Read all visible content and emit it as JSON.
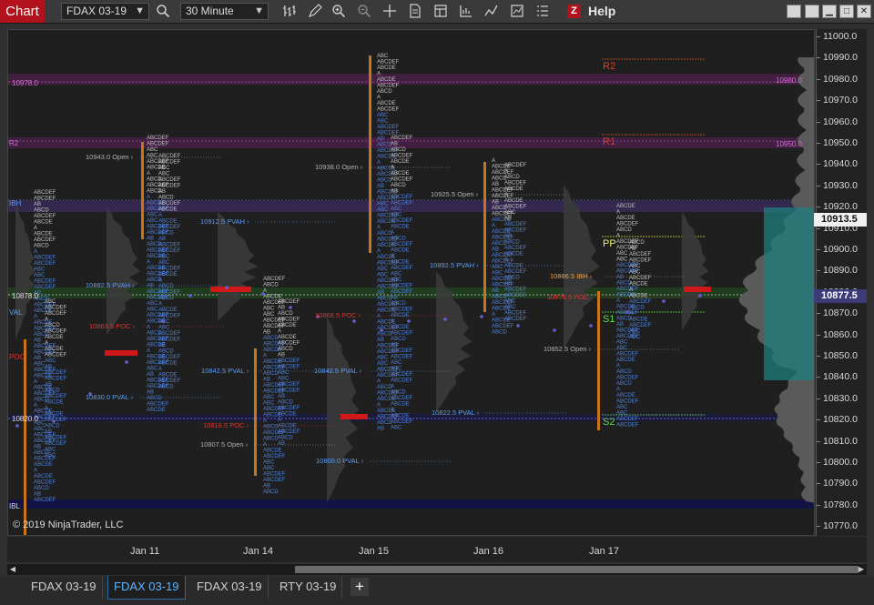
{
  "toolbar": {
    "chart_label": "Chart",
    "instrument": "FDAX 03-19",
    "interval": "30 Minute",
    "help_label": "Help",
    "z_label": "Z"
  },
  "chart": {
    "copyright": "© 2019 NinjaTrader, LLC",
    "x_labels": [
      "Jan 11",
      "Jan 14",
      "Jan 15",
      "Jan 16",
      "Jan 17"
    ],
    "y_labels": [
      "11000.0",
      "10990.0",
      "10980.0",
      "10970.0",
      "10960.0",
      "10950.0",
      "10940.0",
      "10930.0",
      "10920.0",
      "10910.0",
      "10900.0",
      "10890.0",
      "10880.0",
      "10870.0",
      "10860.0",
      "10850.0",
      "10840.0",
      "10830.0",
      "10820.0",
      "10810.0",
      "10800.0",
      "10790.0",
      "10780.0",
      "10770.0"
    ],
    "price_tag_high": "10913.5",
    "price_tag_last": "10877.5",
    "pivots": {
      "r2": "R2",
      "r1": "R1",
      "pp": "PP",
      "s1": "S1",
      "s2": "S2"
    },
    "level_labels": {
      "l10978": "10978.0",
      "l10878": "10878.0",
      "l10820": "10820.0",
      "r2_left": "R2",
      "val_left": "VAL",
      "poc_left": "POC",
      "ibl_left": "IBL",
      "ibh_left": "IBH",
      "l10980_right": "10980.0",
      "l10950_right": "10950.0"
    },
    "annotations": [
      {
        "text": "10943.0 Open",
        "color": "#b0b0b0"
      },
      {
        "text": "10912.5 PVAH",
        "color": "#5e9cf0"
      },
      {
        "text": "10882.5 PVAH",
        "color": "#5e9cf0"
      },
      {
        "text": "10863.5 POC",
        "color": "#e0342f"
      },
      {
        "text": "10830.0 PVAL",
        "color": "#5e9cf0"
      },
      {
        "text": "10938.0 Open",
        "color": "#b0b0b0"
      },
      {
        "text": "10842.5 PVAL",
        "color": "#5e9cf0"
      },
      {
        "text": "10816.5 POC",
        "color": "#e0342f"
      },
      {
        "text": "10807.5 Open",
        "color": "#b0b0b0"
      },
      {
        "text": "10868.5 POC",
        "color": "#e0342f"
      },
      {
        "text": "10842.5 PVAL",
        "color": "#5e9cf0"
      },
      {
        "text": "10800.0 PVAL",
        "color": "#5e9cf0"
      },
      {
        "text": "10925.5 Open",
        "color": "#b0b0b0"
      },
      {
        "text": "10892.5 PVAH",
        "color": "#5e9cf0"
      },
      {
        "text": "10822.5 PVAL",
        "color": "#5e9cf0"
      },
      {
        "text": "10886.5 IBH",
        "color": "#f0a040"
      },
      {
        "text": "10876.5 POC",
        "color": "#e0342f"
      },
      {
        "text": "10852.5 Open",
        "color": "#b0b0b0"
      }
    ]
  },
  "tabs": [
    {
      "label": "FDAX 03-19"
    },
    {
      "label": "FDAX 03-19"
    },
    {
      "label": "FDAX 03-19"
    },
    {
      "label": "RTY 03-19"
    }
  ],
  "colors": {
    "accent_red": "#b1121c",
    "pvah_blue": "#5e9cf0",
    "poc_red": "#e0342f",
    "open_gray": "#b0b0b0",
    "ib_orange": "#e08a20",
    "tpo_blue": "#4f80d8",
    "vwap_purple": "#6a5fd0",
    "profile_teal": "#1f7f7f"
  },
  "icons": [
    "dropdown-icon",
    "search-icon",
    "bar-type-icon",
    "pencil-icon",
    "zoom-in-icon",
    "zoom-out-icon",
    "crosshair-icon",
    "properties-icon",
    "templates-icon",
    "strategies-icon",
    "indicators-icon",
    "data-box-icon",
    "list-icon",
    "close-icon",
    "minimize-icon",
    "maximize-icon",
    "restore-icon"
  ]
}
